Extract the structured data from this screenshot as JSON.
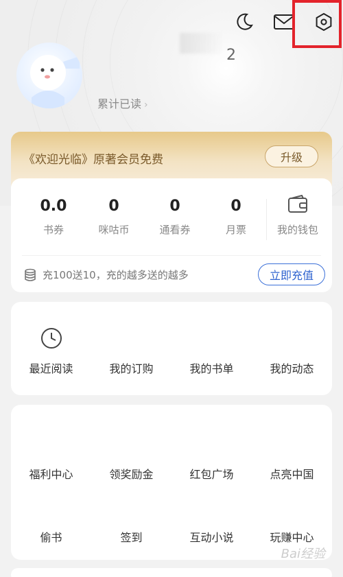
{
  "header": {
    "name_suffix": "2",
    "read_total_label": "累计已读",
    "read_total_chevron": "›",
    "icons": [
      "moon-icon",
      "mail-icon",
      "settings-icon"
    ]
  },
  "vip": {
    "text": "《欢迎光临》原著会员免费",
    "upgrade_label": "升级"
  },
  "wallet": {
    "stats": [
      {
        "value": "0.0",
        "label": "书券"
      },
      {
        "value": "0",
        "label": "咪咕币"
      },
      {
        "value": "0",
        "label": "通看券"
      },
      {
        "value": "0",
        "label": "月票"
      }
    ],
    "wallet_label": "我的钱包",
    "recharge_text": "充100送10，充的越多送的越多",
    "recharge_button": "立即充值"
  },
  "reading_menu": [
    {
      "label": "最近阅读",
      "icon": "clock-icon"
    },
    {
      "label": "我的订购"
    },
    {
      "label": "我的书单"
    },
    {
      "label": "我的动态"
    }
  ],
  "activity_menu": [
    {
      "label": "福利中心"
    },
    {
      "label": "领奖励金"
    },
    {
      "label": "红包广场"
    },
    {
      "label": "点亮中国"
    },
    {
      "label": "偷书"
    },
    {
      "label": "签到"
    },
    {
      "label": "互动小说"
    },
    {
      "label": "玩赚中心"
    }
  ],
  "watermark": "Bai经验",
  "colors": {
    "highlight": "#e3232b",
    "accent_blue": "#2d62cf",
    "vip_gold": "#e7c98a"
  }
}
